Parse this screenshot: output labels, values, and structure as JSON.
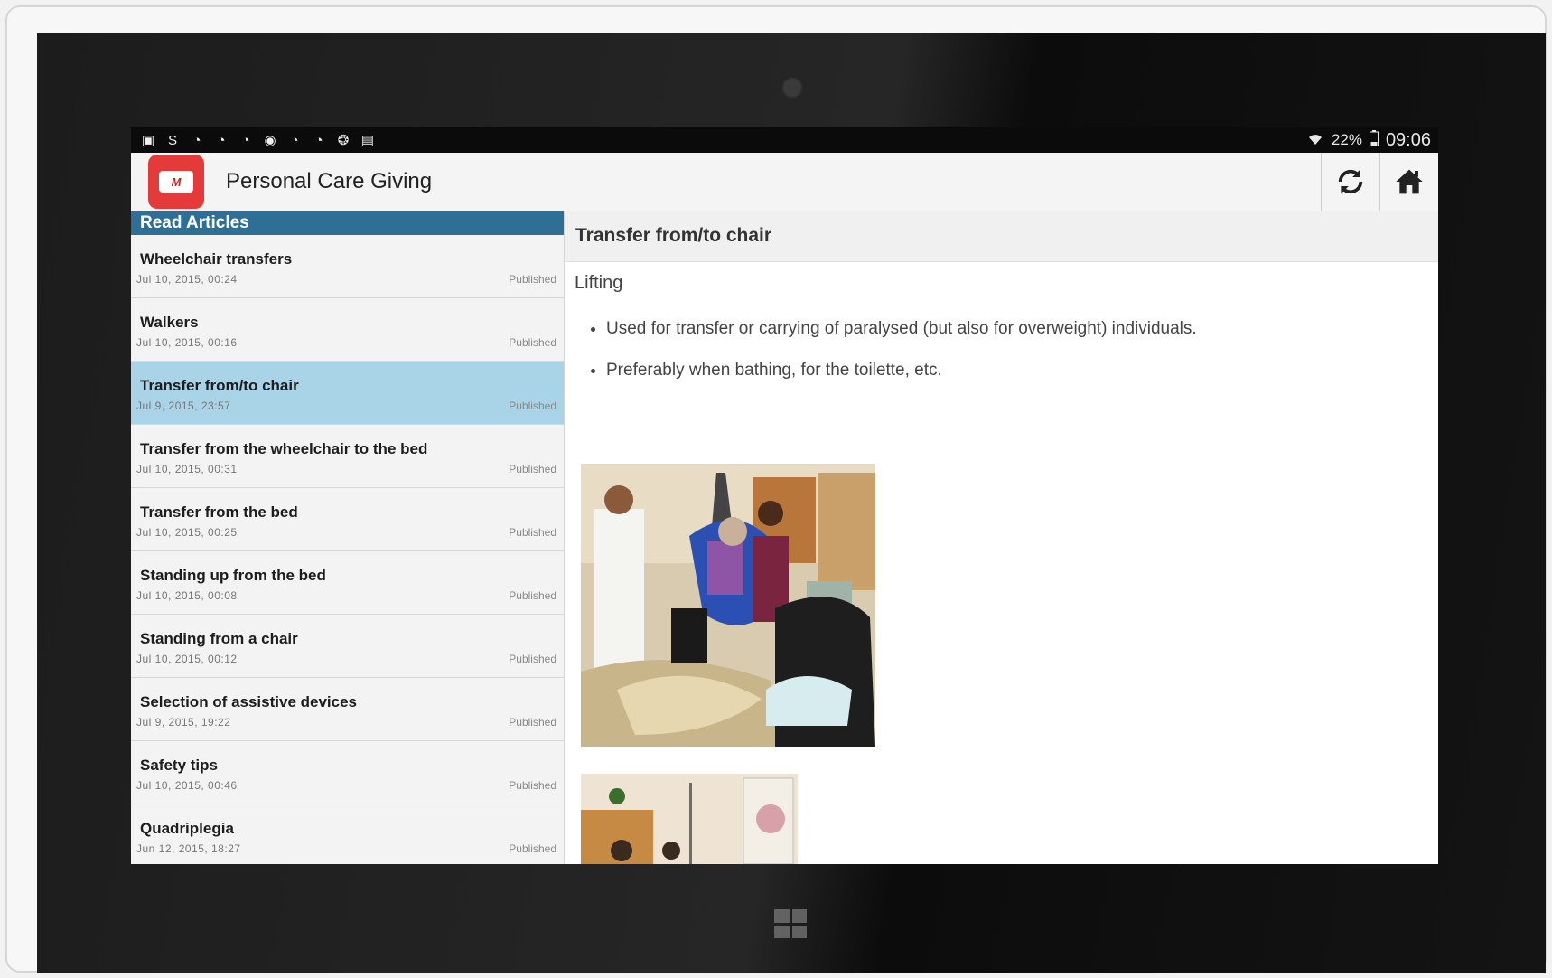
{
  "status_bar": {
    "notification_icons": [
      "gallery-icon",
      "skype-icon",
      "leaf-icon",
      "leaf-icon",
      "leaf-icon",
      "soccer-icon",
      "leaf-icon",
      "leaf-icon",
      "globe-icon",
      "clipboard-icon"
    ],
    "battery": "22%",
    "time": "09:06"
  },
  "app_bar": {
    "logo_text": "M",
    "title": "Personal Care Giving",
    "actions": [
      {
        "name": "refresh",
        "icon": "refresh-icon"
      },
      {
        "name": "home",
        "icon": "home-icon"
      }
    ]
  },
  "articles": {
    "header": "Read Articles",
    "items": [
      {
        "title": "Wheelchair transfers",
        "date": "Jul 10, 2015, 00:24",
        "status": "Published",
        "selected": false
      },
      {
        "title": "Walkers",
        "date": "Jul 10, 2015, 00:16",
        "status": "Published",
        "selected": false
      },
      {
        "title": "Transfer from/to chair",
        "date": "Jul 9, 2015, 23:57",
        "status": "Published",
        "selected": true
      },
      {
        "title": "Transfer from the wheelchair to the bed",
        "date": "Jul 10, 2015, 00:31",
        "status": "Published",
        "selected": false
      },
      {
        "title": "Transfer from the bed",
        "date": "Jul 10, 2015, 00:25",
        "status": "Published",
        "selected": false
      },
      {
        "title": "Standing up from the bed",
        "date": "Jul 10, 2015, 00:08",
        "status": "Published",
        "selected": false
      },
      {
        "title": "Standing from a chair",
        "date": "Jul 10, 2015, 00:12",
        "status": "Published",
        "selected": false
      },
      {
        "title": "Selection of assistive devices",
        "date": "Jul 9, 2015, 19:22",
        "status": "Published",
        "selected": false
      },
      {
        "title": "Safety tips",
        "date": "Jul 10, 2015, 00:46",
        "status": "Published",
        "selected": false
      },
      {
        "title": "Quadriplegia",
        "date": "Jun 12, 2015, 18:27",
        "status": "Published",
        "selected": false
      }
    ]
  },
  "article": {
    "title": "Transfer from/to chair",
    "subheading": "Lifting",
    "bullets": [
      "Used for transfer or carrying of paralysed (but also for overweight) individuals.",
      "Preferably when bathing, for the toilette, etc."
    ]
  },
  "colors": {
    "list_header": "#2f6f96",
    "selected_row": "#a9d3e6",
    "app_logo": "#e53a3a"
  }
}
